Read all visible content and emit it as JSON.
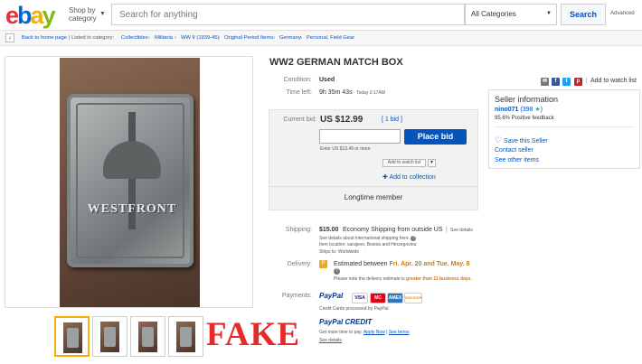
{
  "header": {
    "logo": {
      "e": "e",
      "b": "b",
      "a": "a",
      "y": "y"
    },
    "shop_by_line1": "Shop by",
    "shop_by_line2": "category",
    "search_placeholder": "Search for anything",
    "category_select": "All Categories",
    "search_button": "Search",
    "advanced": "Advanced"
  },
  "breadcrumb": {
    "back_label": "Back to home page",
    "listed_in": "| Listed in category:",
    "items": [
      "Collectibles",
      "Militaria",
      "WW II (1939-45)",
      "Original Period Items",
      "Germany",
      "Personal, Field Gear"
    ]
  },
  "image": {
    "box_text": "WESTFRONT",
    "overlay_text": "FAKE"
  },
  "listing": {
    "title": "WW2 GERMAN MATCH BOX",
    "condition_label": "Condition:",
    "condition_value": "Used",
    "time_left_label": "Time left:",
    "time_left_value": "9h 35m 43s",
    "time_left_detail": "Today 2:17AM",
    "add_to_watch_list": "Add to watch list",
    "current_bid_label": "Current bid:",
    "current_bid": "US $12.99",
    "bid_count": "[ 1 bid ]",
    "place_bid": "Place bid",
    "enter_hint": "Enter US $13.49 or more",
    "watch_btn": "Add to watch list",
    "add_collection": "Add to collection",
    "longtime": "Longtime member",
    "shipping_label": "Shipping:",
    "shipping_price": "$15.00",
    "shipping_text": "Economy Shipping from outside US",
    "see_details": "See details",
    "shipping_note": "See details about international shipping here.",
    "item_location": "Item location:  sarajevo, Bosnia and Herzegovina",
    "ships_to": "Ships to:  Worldwide",
    "delivery_label": "Delivery:",
    "delivery_text": "Estimated between",
    "delivery_dates": "Fri. Apr. 20 and Tue. May. 8",
    "delivery_note_1": "Please note the delivery estimate is",
    "delivery_note_2": "greater than 11 business days.",
    "payments_label": "Payments:",
    "paypal": "PayPal",
    "cards": [
      "VISA",
      "MC",
      "AMEX",
      "DISCOVER"
    ],
    "cards_processed": "Credit Cards processed by PayPal",
    "paypal_credit": "PayPal CREDIT",
    "credit_text": "Get more time to pay.",
    "apply_now": "Apply Now",
    "see_terms": "See terms",
    "credit_details": "See details"
  },
  "seller": {
    "heading": "Seller information",
    "name": "nino071",
    "score": "(398",
    "feedback": "95.6% Positive feedback",
    "save": "Save this Seller",
    "contact": "Contact seller",
    "other": "See other items"
  },
  "colors": {
    "accent": "#0654ba",
    "fake_red": "#e52a2a",
    "delivery_orange": "#dd7700"
  }
}
